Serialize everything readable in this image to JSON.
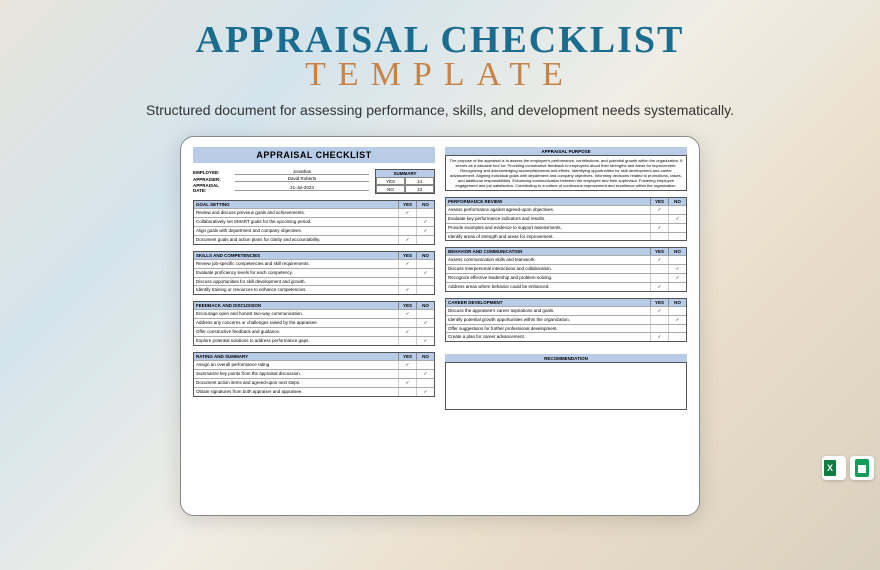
{
  "header": {
    "title_main": "APPRAISAL CHECKLIST",
    "title_sub": "TEMPLATE",
    "subtitle": "Structured document for assessing performance, skills, and development needs systematically."
  },
  "doc": {
    "title": "APPRAISAL CHECKLIST",
    "meta": {
      "employee_label": "EMPLOYEE:",
      "employee": "Jonathan",
      "appraiser_label": "APPRAISER:",
      "appraiser": "David Roberts",
      "date_label": "APPRAISAL DATE:",
      "date": "21-Jul-2023"
    },
    "summary": {
      "label": "SUMMARY",
      "yes_label": "YES",
      "no_label": "NO",
      "yes": "14",
      "no": "13"
    },
    "yes": "YES",
    "no": "NO",
    "purpose": {
      "title": "APPRAISAL PURPOSE",
      "body": "The purpose of the appraisal is to assess the employee's performance, contributions, and potential growth within the organization. It serves as a valuable tool for: Providing constructive feedback to employees about their strengths and areas for improvement. Recognizing and acknowledging accomplishments and efforts. Identifying opportunities for skill development and career advancement. Aligning individual goals with department and company objectives. Informing decisions related to promotions, raises, and additional responsibilities. Enhancing communication between the employee and their supervisor. Fostering employee engagement and job satisfaction. Contributing to a culture of continuous improvement and excellence within the organization."
    },
    "sections_left": [
      {
        "title": "GOAL SETTING",
        "rows": [
          {
            "t": "Review and discuss previous goals and achievements.",
            "y": "✓",
            "n": ""
          },
          {
            "t": "Collaboratively set SMART goals for the upcoming period.",
            "y": "",
            "n": "✓"
          },
          {
            "t": "Align goals with department and company objectives.",
            "y": "",
            "n": "✓"
          },
          {
            "t": "Document goals and action plans for clarity and accountability.",
            "y": "✓",
            "n": ""
          }
        ]
      },
      {
        "title": "SKILLS AND COMPETENCIES",
        "rows": [
          {
            "t": "Review job-specific competencies and skill requirements.",
            "y": "✓",
            "n": ""
          },
          {
            "t": "Evaluate proficiency levels for each competency.",
            "y": "",
            "n": "✓"
          },
          {
            "t": "Discuss opportunities for skill development and growth.",
            "y": "",
            "n": ""
          },
          {
            "t": "Identify training or resources to enhance competencies.",
            "y": "✓",
            "n": ""
          }
        ]
      },
      {
        "title": "FEEDBACK AND DISCUSSION",
        "rows": [
          {
            "t": "Encourage open and honest two-way communication.",
            "y": "✓",
            "n": ""
          },
          {
            "t": "Address any concerns or challenges raised by the appraisee.",
            "y": "",
            "n": "✓"
          },
          {
            "t": "Offer constructive feedback and guidance.",
            "y": "✓",
            "n": ""
          },
          {
            "t": "Explore potential solutions to address performance gaps.",
            "y": "",
            "n": "✓"
          }
        ]
      },
      {
        "title": "RATING AND SUMMARY",
        "rows": [
          {
            "t": "Assign an overall performance rating.",
            "y": "✓",
            "n": ""
          },
          {
            "t": "Summarize key points from the appraisal discussion.",
            "y": "",
            "n": "✓"
          },
          {
            "t": "Document action items and agreed-upon next steps.",
            "y": "✓",
            "n": ""
          },
          {
            "t": "Obtain signatures from both appraiser and appraisee.",
            "y": "",
            "n": "✓"
          }
        ]
      }
    ],
    "sections_right": [
      {
        "title": "PERFORMANCE REVIEW",
        "rows": [
          {
            "t": "Assess performance against agreed-upon objectives.",
            "y": "✓",
            "n": ""
          },
          {
            "t": "Evaluate key performance indicators and results.",
            "y": "",
            "n": "✓"
          },
          {
            "t": "Provide examples and evidence to support assessments.",
            "y": "✓",
            "n": ""
          },
          {
            "t": "Identify areas of strength and areas for improvement.",
            "y": "",
            "n": ""
          }
        ]
      },
      {
        "title": "BEHAVIOR AND COMMUNICATION",
        "rows": [
          {
            "t": "Assess communication skills and teamwork.",
            "y": "✓",
            "n": ""
          },
          {
            "t": "Discuss interpersonal interactions and collaboration.",
            "y": "",
            "n": "✓"
          },
          {
            "t": "Recognize effective leadership and problem-solving.",
            "y": "",
            "n": "✓"
          },
          {
            "t": "Address areas where behavior could be enhanced.",
            "y": "✓",
            "n": ""
          }
        ]
      },
      {
        "title": "CAREER DEVELOPMENT",
        "rows": [
          {
            "t": "Discuss the appraisee's career aspirations and goals.",
            "y": "✓",
            "n": ""
          },
          {
            "t": "Identify potential growth opportunities within the organization.",
            "y": "",
            "n": "✓"
          },
          {
            "t": "Offer suggestions for further professional development.",
            "y": "",
            "n": ""
          },
          {
            "t": "Create a plan for career advancement.",
            "y": "✓",
            "n": ""
          }
        ]
      }
    ],
    "recommend_title": "RECOMMENDATION"
  }
}
